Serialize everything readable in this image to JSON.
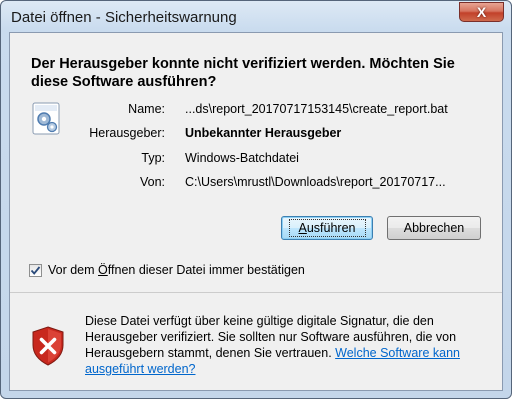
{
  "window": {
    "title": "Datei öffnen - Sicherheitswarnung",
    "close_symbol": "X"
  },
  "heading": "Der Herausgeber konnte nicht verifiziert werden. Möchten Sie diese Software ausführen?",
  "file_icon": "batch-file-icon",
  "info": [
    {
      "label": "Name:",
      "value": "...ds\\report_20170717153145\\create_report.bat",
      "bold": false
    },
    {
      "label": "Herausgeber:",
      "value": "Unbekannter Herausgeber",
      "bold": true
    },
    {
      "label": "Typ:",
      "value": "Windows-Batchdatei",
      "bold": false
    },
    {
      "label": "Von:",
      "value": "C:\\Users\\mrustl\\Downloads\\report_20170717...",
      "bold": false
    }
  ],
  "buttons": {
    "run": {
      "accel": "A",
      "rest": "usführen"
    },
    "cancel": "Abbrechen"
  },
  "checkbox": {
    "label_pre": "Vor dem ",
    "label_accel": "Ö",
    "label_post": "ffnen dieser Datei immer bestätigen",
    "checked": true
  },
  "warning": {
    "icon": "security-shield-icon",
    "text": "Diese Datei verfügt über keine gültige digitale Signatur, die den Herausgeber verifiziert. Sie sollten nur Software ausführen, die von Herausgebern stammt, denen Sie vertrauen. ",
    "link": "Welche Software kann ausgeführt werden?"
  },
  "colors": {
    "link": "#0066cc",
    "shield_red": "#c8281e",
    "close_red": "#c2412a"
  }
}
